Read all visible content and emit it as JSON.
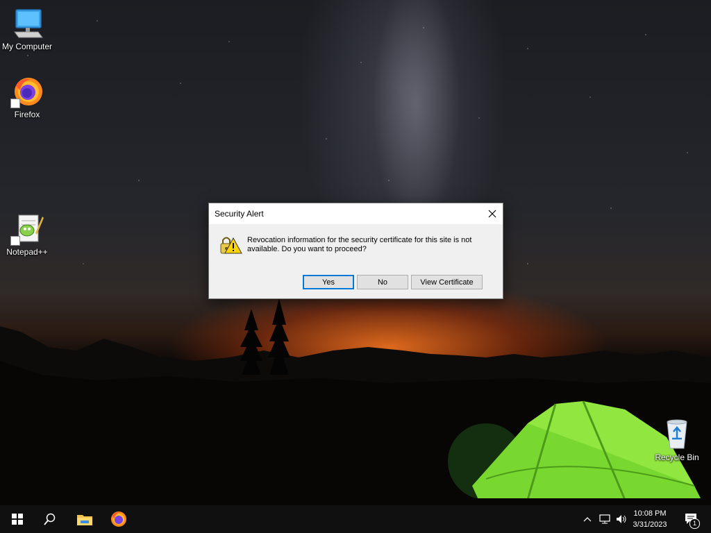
{
  "desktop": {
    "icons": [
      {
        "label": "My Computer",
        "icon": "computer-icon"
      },
      {
        "label": "Firefox",
        "icon": "firefox-icon"
      },
      {
        "label": "Notepad++",
        "icon": "notepad-plus-plus-icon"
      },
      {
        "label": "Recycle Bin",
        "icon": "recycle-bin-icon"
      }
    ]
  },
  "dialog": {
    "title": "Security Alert",
    "message": "Revocation information for the security certificate for this site is not available. Do you want to proceed?",
    "buttons": {
      "yes": "Yes",
      "no": "No",
      "view_certificate": "View Certificate"
    },
    "icon": "warning-lock-icon"
  },
  "taskbar": {
    "clock": {
      "time": "10:08 PM",
      "date": "3/31/2023"
    },
    "notification_count": "1",
    "pinned": [
      "start-icon",
      "search-icon",
      "file-explorer-icon",
      "firefox-icon"
    ],
    "tray": [
      "chevron-up-icon",
      "network-icon",
      "volume-icon"
    ]
  },
  "colors": {
    "accent": "#0078d7",
    "taskbar": "#101010",
    "dialog_bg": "#f0f0f0"
  }
}
